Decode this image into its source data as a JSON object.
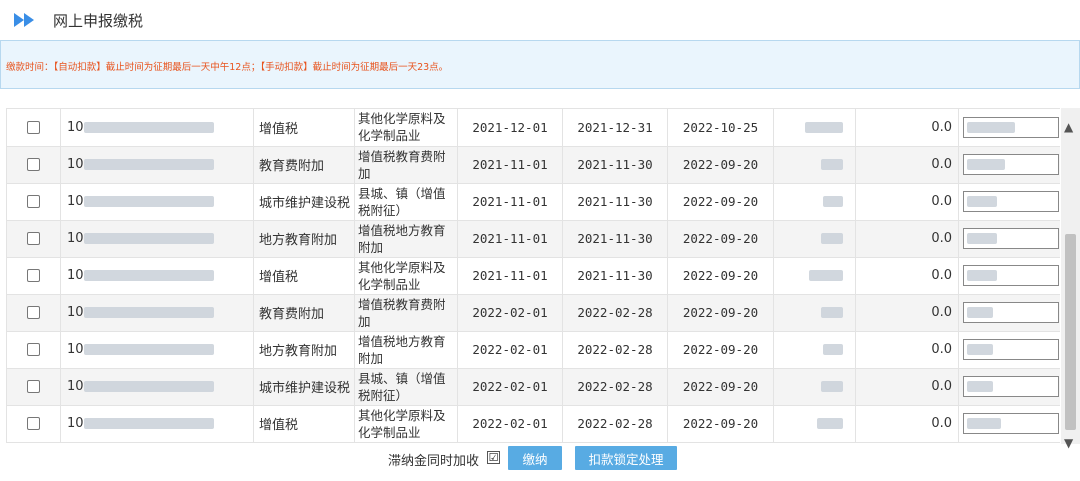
{
  "header": {
    "title": "网上申报缴税",
    "icon": "double-arrow-right-icon"
  },
  "notice": "缴款时间：【自动扣款】截止时间为征期最后一天中午12点；【手动扣款】截止时间为征期最后一天23点。",
  "rows": [
    {
      "id_prefix": "10",
      "tax": "增值税",
      "item": "其他化学原料及化学制品业",
      "start": "2021-12-01",
      "end": "2021-12-31",
      "due": "2022-10-25",
      "paid": "0.0"
    },
    {
      "id_prefix": "10",
      "tax": "教育费附加",
      "item": "增值税教育费附加",
      "start": "2021-11-01",
      "end": "2021-11-30",
      "due": "2022-09-20",
      "paid": "0.0"
    },
    {
      "id_prefix": "10",
      "tax": "城市维护建设税",
      "item": "县城、镇（增值税附征）",
      "start": "2021-11-01",
      "end": "2021-11-30",
      "due": "2022-09-20",
      "paid": "0.0"
    },
    {
      "id_prefix": "10",
      "tax": "地方教育附加",
      "item": "增值税地方教育附加",
      "start": "2021-11-01",
      "end": "2021-11-30",
      "due": "2022-09-20",
      "paid": "0.0"
    },
    {
      "id_prefix": "10",
      "tax": "增值税",
      "item": "其他化学原料及化学制品业",
      "start": "2021-11-01",
      "end": "2021-11-30",
      "due": "2022-09-20",
      "paid": "0.0"
    },
    {
      "id_prefix": "10",
      "tax": "教育费附加",
      "item": "增值税教育费附加",
      "start": "2022-02-01",
      "end": "2022-02-28",
      "due": "2022-09-20",
      "paid": "0.0"
    },
    {
      "id_prefix": "10",
      "tax": "地方教育附加",
      "item": "增值税地方教育附加",
      "start": "2022-02-01",
      "end": "2022-02-28",
      "due": "2022-09-20",
      "paid": "0.0"
    },
    {
      "id_prefix": "10",
      "tax": "城市维护建设税",
      "item": "县城、镇（增值税附征）",
      "start": "2022-02-01",
      "end": "2022-02-28",
      "due": "2022-09-20",
      "paid": "0.0"
    },
    {
      "id_prefix": "10",
      "tax": "增值税",
      "item": "其他化学原料及化学制品业",
      "start": "2022-02-01",
      "end": "2022-02-28",
      "due": "2022-09-20",
      "paid": "0.0"
    }
  ],
  "footer": {
    "late_fee_label": "滞纳金同时加收",
    "late_fee_checked": "☑",
    "pay_label": "缴纳",
    "lock_label": "扣款锁定处理"
  },
  "colors": {
    "accent": "#58abe3",
    "notice_text": "#e8541e",
    "notice_bg": "#eaf5fd"
  }
}
